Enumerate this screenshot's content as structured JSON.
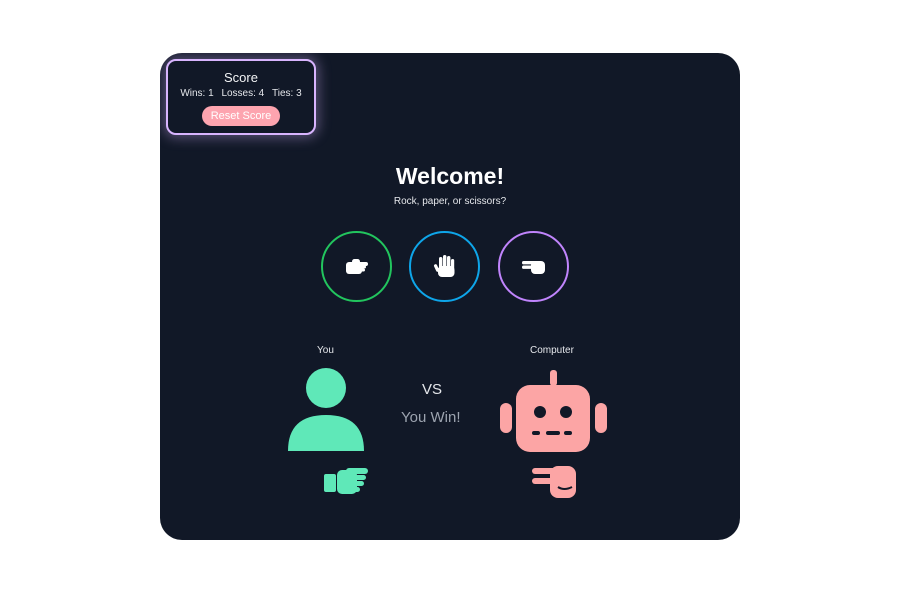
{
  "score": {
    "title": "Score",
    "wins_label": "Wins: 1",
    "losses_label": "Losses: 4",
    "ties_label": "Ties: 3",
    "reset_label": "Reset Score"
  },
  "game": {
    "title": "Welcome!",
    "subtitle": "Rock, paper, or scissors?",
    "choices": [
      {
        "name": "rock",
        "icon": "fist-icon",
        "color": "#22c55e"
      },
      {
        "name": "paper",
        "icon": "open-hand-icon",
        "color": "#0ea5e9"
      },
      {
        "name": "scissors",
        "icon": "scissors-hand-icon",
        "color": "#c084fc"
      }
    ]
  },
  "match": {
    "player_label": "You",
    "computer_label": "Computer",
    "vs_label": "VS",
    "result": "You Win!",
    "player_avatar": "user-icon",
    "computer_avatar": "robot-icon",
    "player_hand": "fist-icon",
    "computer_hand": "scissors-hand-icon",
    "player_color": "#5eead4",
    "computer_color": "#fca5a5"
  },
  "colors": {
    "background": "#111827",
    "card_border": "#d8b4fe",
    "reset_button": "#fda4af"
  }
}
